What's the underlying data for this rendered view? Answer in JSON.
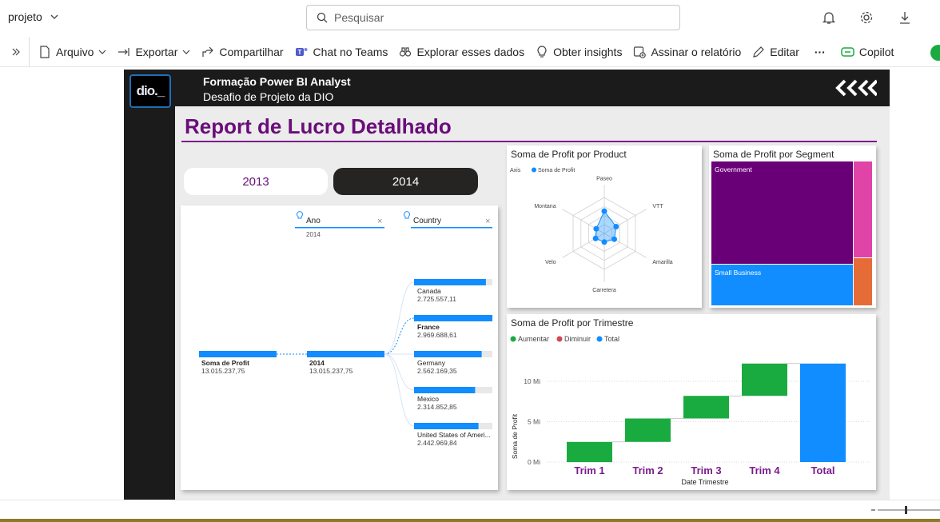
{
  "app": {
    "workspace": "projeto",
    "search_placeholder": "Pesquisar"
  },
  "toolbar": {
    "file": "Arquivo",
    "export": "Exportar",
    "share": "Compartilhar",
    "teams": "Chat no Teams",
    "explore": "Explorar esses dados",
    "insights": "Obter insights",
    "subscribe": "Assinar o relatório",
    "edit": "Editar",
    "more": "···",
    "copilot": "Copilot"
  },
  "report": {
    "logo_text": "dio._",
    "header_title": "Formação Power BI Analyst",
    "header_subtitle": "Desafio de Projeto da DIO",
    "page_title": "Report de Lucro Detalhado",
    "years": [
      "2013",
      "2014"
    ],
    "selected_year": "2014"
  },
  "colors": {
    "accent": "#118dff",
    "brand_purple": "#6a0d7a",
    "increase": "#1aab40",
    "decrease": "#d64550",
    "total": "#118dff"
  },
  "decomposition": {
    "level1_label": "Ano",
    "level1_value": "2014",
    "level2_label": "Country",
    "root": {
      "name": "Soma de Profit",
      "value": "13.015.237,75"
    },
    "year_node": {
      "name": "2014",
      "value": "13.015.237,75"
    },
    "countries": [
      {
        "name": "Canada",
        "value": "2.725.557,11",
        "amount": 2725557.11
      },
      {
        "name": "France",
        "value": "2.969.688,61",
        "amount": 2969688.61
      },
      {
        "name": "Germany",
        "value": "2.562.169,35",
        "amount": 2562169.35
      },
      {
        "name": "Mexico",
        "value": "2.314.852,85",
        "amount": 2314852.85
      },
      {
        "name": "United States of Ameri...",
        "value": "2.442.969,84",
        "amount": 2442969.84
      }
    ]
  },
  "radar": {
    "title": "Soma de Profit por Product",
    "legend_axis": "Axis",
    "legend_series": "Soma de Profit",
    "axes": [
      "Paseo",
      "VTT",
      "Amarilla",
      "Carretera",
      "Velo",
      "Montana"
    ],
    "values": [
      0.62,
      0.38,
      0.32,
      0.24,
      0.28,
      0.26
    ]
  },
  "treemap": {
    "title": "Soma de Profit por Segment",
    "segments": [
      {
        "name": "Government",
        "color": "#6a0078"
      },
      {
        "name": "Small Business",
        "color": "#118dff"
      },
      {
        "name": "",
        "color": "#e044a7"
      },
      {
        "name": "",
        "color": "#e66c37"
      }
    ]
  },
  "chart_data": {
    "type": "waterfall",
    "title": "Soma de Profit por Trimestre",
    "legend": [
      "Aumentar",
      "Diminuir",
      "Total"
    ],
    "xlabel": "Date Trimestre",
    "ylabel": "Soma de Profit",
    "yticks": [
      "0 Mi",
      "5 Mi",
      "10 Mi"
    ],
    "ylim": [
      0,
      14
    ],
    "categories": [
      "Trim 1",
      "Trim 2",
      "Trim 3",
      "Trim 4",
      "Total"
    ],
    "values": [
      2.5,
      2.9,
      2.8,
      4.0,
      12.2
    ]
  }
}
